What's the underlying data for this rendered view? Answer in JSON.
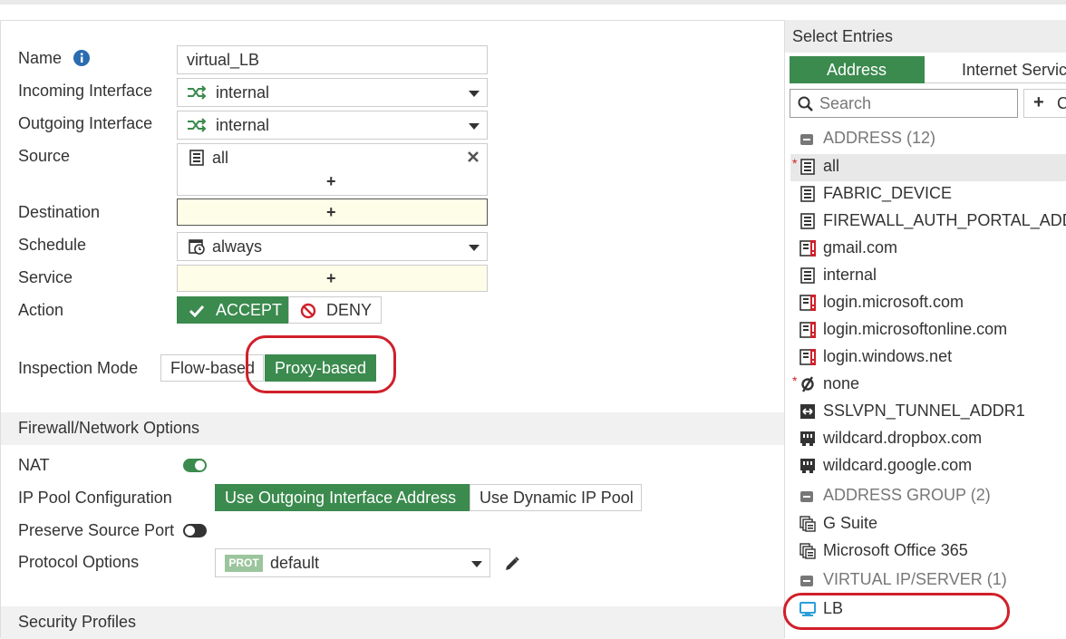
{
  "form": {
    "name_label": "Name",
    "name_value": "virtual_LB",
    "incoming_label": "Incoming Interface",
    "incoming_value": "internal",
    "outgoing_label": "Outgoing Interface",
    "outgoing_value": "internal",
    "source_label": "Source",
    "source_value": "all",
    "destination_label": "Destination",
    "schedule_label": "Schedule",
    "schedule_value": "always",
    "service_label": "Service",
    "action_label": "Action",
    "accept_label": "ACCEPT",
    "deny_label": "DENY",
    "plus": "+",
    "inspection_label": "Inspection Mode",
    "flow_based": "Flow-based",
    "proxy_based": "Proxy-based"
  },
  "firewall": {
    "section_title": "Firewall/Network Options",
    "nat_label": "NAT",
    "nat_enabled": true,
    "ip_pool_label": "IP Pool Configuration",
    "ip_pool_options": [
      "Use Outgoing Interface Address",
      "Use Dynamic IP Pool"
    ],
    "preserve_label": "Preserve Source Port",
    "preserve_enabled": false,
    "protocol_label": "Protocol Options",
    "protocol_badge": "PROT",
    "protocol_value": "default"
  },
  "security": {
    "section_title": "Security Profiles"
  },
  "select_entries": {
    "title": "Select Entries",
    "tabs": [
      "Address",
      "Internet Servic"
    ],
    "search_placeholder": "Search",
    "create_label": "C",
    "groups": [
      {
        "label": "ADDRESS (12)"
      },
      {
        "label": "ADDRESS GROUP (2)"
      },
      {
        "label": "VIRTUAL IP/SERVER (1)"
      }
    ],
    "items": [
      {
        "label": "all",
        "icon": "address-icon"
      },
      {
        "label": "FABRIC_DEVICE",
        "icon": "address-icon"
      },
      {
        "label": "FIREWALL_AUTH_PORTAL_ADD",
        "icon": "address-icon"
      },
      {
        "label": "gmail.com",
        "icon": "address-warning-icon"
      },
      {
        "label": "internal",
        "icon": "address-icon"
      },
      {
        "label": "login.microsoft.com",
        "icon": "address-warning-icon"
      },
      {
        "label": "login.microsoftonline.com",
        "icon": "address-warning-icon"
      },
      {
        "label": "login.windows.net",
        "icon": "address-warning-icon"
      },
      {
        "label": "none",
        "icon": "none-icon"
      },
      {
        "label": "SSLVPN_TUNNEL_ADDR1",
        "icon": "range-icon"
      },
      {
        "label": "wildcard.dropbox.com",
        "icon": "wildcard-icon"
      },
      {
        "label": "wildcard.google.com",
        "icon": "wildcard-icon"
      },
      {
        "label": "G Suite",
        "icon": "group-icon"
      },
      {
        "label": "Microsoft Office 365",
        "icon": "group-icon"
      },
      {
        "label": "LB",
        "icon": "virtual-server-icon"
      }
    ]
  },
  "colors": {
    "accent_green": "#3b8a4e",
    "highlight_red": "#d0202a"
  }
}
